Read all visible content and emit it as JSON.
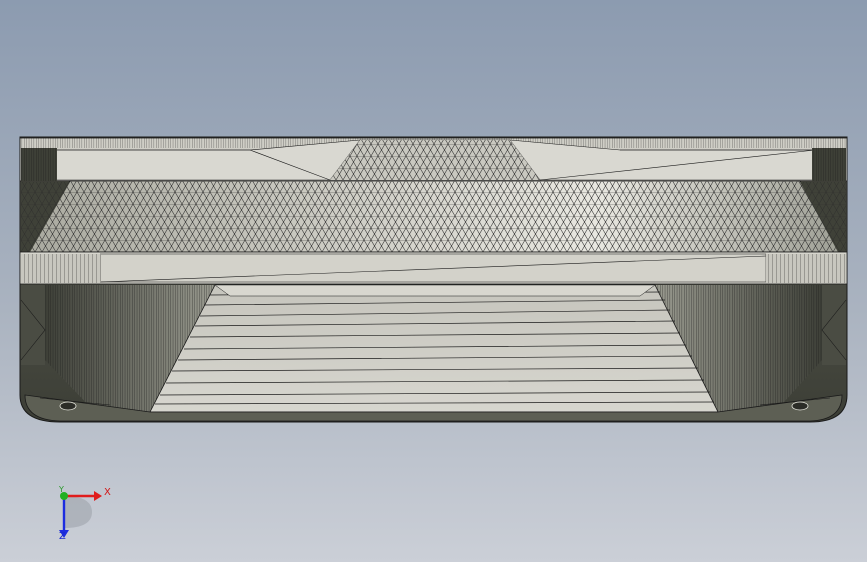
{
  "viewport": {
    "background_top": "#8d9cb0",
    "background_bottom": "#c9ced6"
  },
  "model": {
    "face_light": "#d9d8d0",
    "face_mid": "#b8b7ae",
    "face_dark": "#55574c",
    "edge_color": "#1a1a1a"
  },
  "triad": {
    "x_label": "X",
    "y_label": "Y",
    "z_label": "Z",
    "x_color": "#e01c1c",
    "y_color": "#22b022",
    "z_color": "#1c2ce0"
  }
}
